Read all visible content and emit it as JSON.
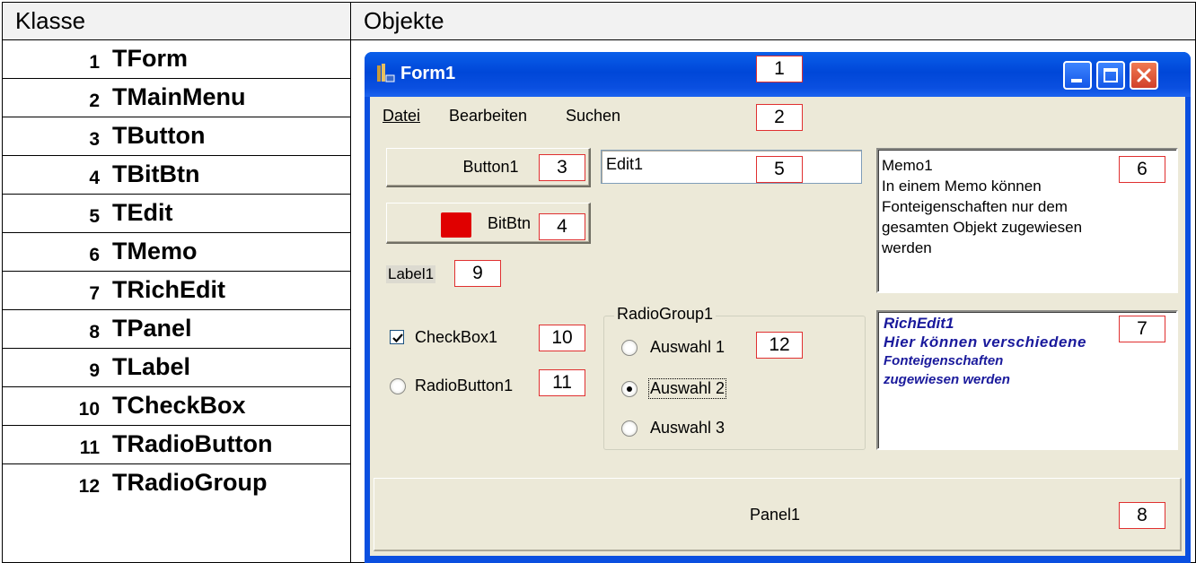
{
  "table": {
    "header_class": "Klasse",
    "header_objects": "Objekte",
    "rows": [
      {
        "num": "1",
        "name": "TForm"
      },
      {
        "num": "2",
        "name": "TMainMenu"
      },
      {
        "num": "3",
        "name": "TButton"
      },
      {
        "num": "4",
        "name": "TBitBtn"
      },
      {
        "num": "5",
        "name": "TEdit"
      },
      {
        "num": "6",
        "name": "TMemo"
      },
      {
        "num": "7",
        "name": "TRichEdit"
      },
      {
        "num": "8",
        "name": "TPanel"
      },
      {
        "num": "9",
        "name": "TLabel"
      },
      {
        "num": "10",
        "name": "TCheckBox"
      },
      {
        "num": "11",
        "name": "TRadioButton"
      },
      {
        "num": "12",
        "name": "TRadioGroup"
      }
    ]
  },
  "window": {
    "title": "Form1",
    "menu": [
      "Datei",
      "Bearbeiten",
      "Suchen"
    ],
    "button1": "Button1",
    "bitbtn": "BitBtn",
    "edit": "Edit1",
    "label": "Label1",
    "checkbox": "CheckBox1",
    "checkbox_checked": true,
    "radiobutton": "RadioButton1",
    "radiogroup": {
      "title": "RadioGroup1",
      "items": [
        "Auswahl 1",
        "Auswahl 2",
        "Auswahl 3"
      ],
      "selected_index": 1
    },
    "memo_lines": [
      "Memo1",
      "In einem Memo können",
      "Fonteigenschaften nur dem",
      "gesamten Objekt zugewiesen",
      "werden"
    ],
    "richedit_lines": [
      "RichEdit1",
      "Hier können verschiedene",
      "Fonteigenschaften",
      "zugewiesen werden"
    ],
    "panel": "Panel1"
  },
  "tags": [
    "1",
    "2",
    "3",
    "4",
    "5",
    "6",
    "7",
    "8",
    "9",
    "10",
    "11",
    "12"
  ],
  "colors": {
    "titlebar": "#0a4fe0",
    "window_bg": "#ece9d8",
    "tag_border": "#e03030",
    "richedit_text": "#1a1a9c"
  }
}
